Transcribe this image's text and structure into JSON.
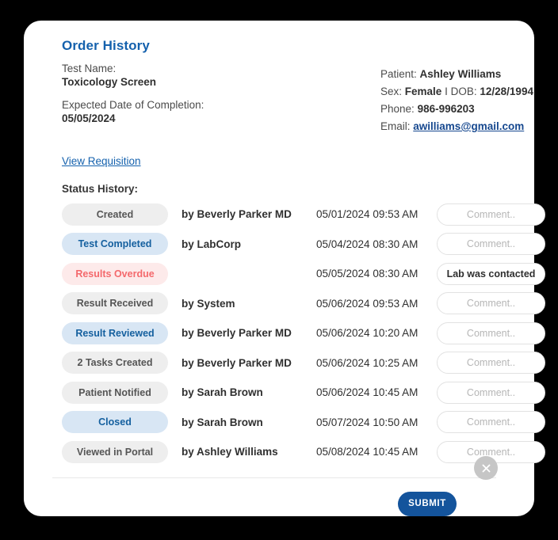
{
  "card": {
    "title": "Order History",
    "test_name_label": "Test Name:",
    "test_name_value": "Toxicology Screen",
    "expected_date_label": "Expected Date of Completion:",
    "expected_date_value": "05/05/2024",
    "view_requisition_link": "View Requisition",
    "status_history_label": "Status History:"
  },
  "patient": {
    "patient_label": "Patient:",
    "patient_name": "Ashley Williams",
    "sex_label": "Sex:",
    "sex_value": "Female",
    "separator": "I",
    "dob_label": "DOB:",
    "dob_value": "12/28/1994",
    "phone_label": "Phone:",
    "phone_value": "986-996203",
    "email_label": "Email:",
    "email_value": "awilliams@gmail.com"
  },
  "status_rows": [
    {
      "status": "Created",
      "tone": "gray",
      "actor": "by Beverly Parker MD",
      "date": "05/01/2024 09:53 AM",
      "comment_value": "",
      "comment_placeholder": "Comment.."
    },
    {
      "status": "Test Completed",
      "tone": "blue",
      "actor": "by LabCorp",
      "date": "05/04/2024 08:30 AM",
      "comment_value": "",
      "comment_placeholder": "Comment.."
    },
    {
      "status": "Results Overdue",
      "tone": "red",
      "actor": "",
      "date": "05/05/2024 08:30 AM",
      "comment_value": "Lab was contacted",
      "comment_placeholder": "Comment.."
    },
    {
      "status": "Result Received",
      "tone": "gray",
      "actor": "by System",
      "date": "05/06/2024 09:53 AM",
      "comment_value": "",
      "comment_placeholder": "Comment.."
    },
    {
      "status": "Result Reviewed",
      "tone": "blue",
      "actor": "by Beverly Parker MD",
      "date": "05/06/2024 10:20 AM",
      "comment_value": "",
      "comment_placeholder": "Comment.."
    },
    {
      "status": "2 Tasks Created",
      "tone": "gray",
      "actor": "by Beverly Parker MD",
      "date": "05/06/2024 10:25 AM",
      "comment_value": "",
      "comment_placeholder": "Comment.."
    },
    {
      "status": "Patient Notified",
      "tone": "gray",
      "actor": "by Sarah Brown",
      "date": "05/06/2024 10:45 AM",
      "comment_value": "",
      "comment_placeholder": "Comment.."
    },
    {
      "status": "Closed",
      "tone": "blue",
      "actor": "by Sarah Brown",
      "date": "05/07/2024 10:50 AM",
      "comment_value": "",
      "comment_placeholder": "Comment.."
    },
    {
      "status": "Viewed in Portal",
      "tone": "gray",
      "actor": "by Ashley Williams",
      "date": "05/08/2024 10:45 AM",
      "comment_value": "",
      "comment_placeholder": "Comment.."
    }
  ],
  "footer": {
    "submit_label": "SUBMIT",
    "close_icon": "close-icon"
  },
  "colors": {
    "title_blue": "#1461ad",
    "submit_blue": "#14549c",
    "badge_blue_bg": "#d8e6f4",
    "badge_blue_text": "#15609f",
    "badge_red_bg": "#fdeaea",
    "badge_red_text": "#f4696c",
    "badge_gray_bg": "#eeeeee",
    "badge_gray_text": "#555555",
    "close_gray": "#c6c6c6",
    "page_bg": "#000000"
  }
}
